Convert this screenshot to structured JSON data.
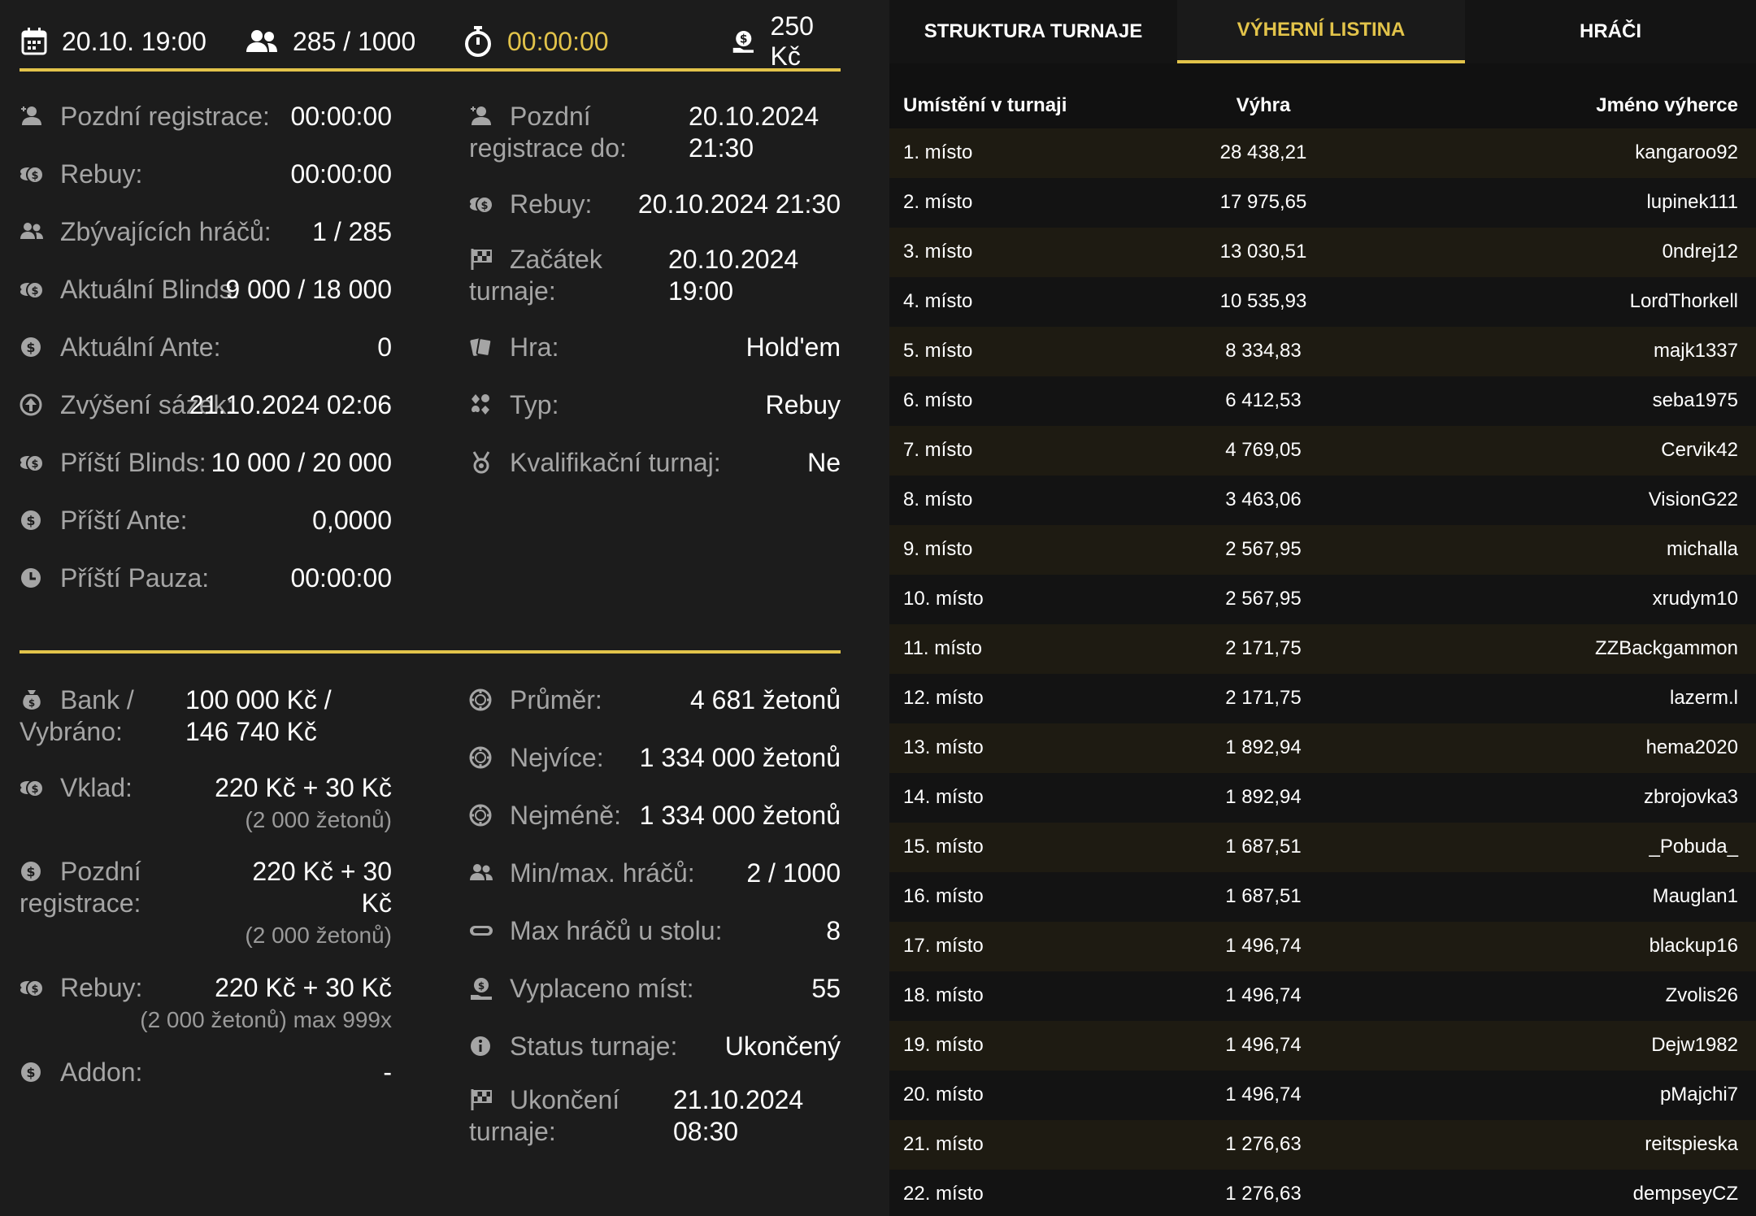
{
  "topbar": {
    "date": "20.10. 19:00",
    "players": "285 / 1000",
    "timer": "00:00:00",
    "buyin": "250 Kč"
  },
  "info_left": [
    {
      "label": "Pozdní registrace:",
      "value": "00:00:00",
      "icon": "late-registration-icon"
    },
    {
      "label": "Rebuy:",
      "value": "00:00:00",
      "icon": "coins-icon"
    },
    {
      "label": "Zbývajících hráčů:",
      "value": "1 / 285",
      "icon": "users-icon"
    },
    {
      "label": "Aktuální Blinds:",
      "value": "9 000 / 18 000",
      "icon": "coins-icon"
    },
    {
      "label": "Aktuální Ante:",
      "value": "0",
      "icon": "dollar-coin-icon"
    },
    {
      "label": "Zvýšení sázek:",
      "value": "21.10.2024 02:06",
      "icon": "arrow-up-circle-icon"
    },
    {
      "label": "Příští Blinds:",
      "value": "10 000 / 20 000",
      "icon": "coins-icon"
    },
    {
      "label": "Příští Ante:",
      "value": "0,0000",
      "icon": "dollar-coin-icon"
    },
    {
      "label": "Příští Pauza:",
      "value": "00:00:00",
      "icon": "clock-icon"
    }
  ],
  "info_right": [
    {
      "label": "Pozdní registrace do:",
      "value_line1": "20.10.2024",
      "value_line2": "21:30",
      "icon": "late-registration-icon"
    },
    {
      "label": "Rebuy:",
      "value": "20.10.2024 21:30",
      "icon": "coins-icon"
    },
    {
      "label": "Začátek turnaje:",
      "value_line1": "20.10.2024",
      "value_line2": "19:00",
      "icon": "checkered-flag-icon"
    },
    {
      "label": "Hra:",
      "value": "Hold'em",
      "icon": "cards-icon"
    },
    {
      "label": "Typ:",
      "value": "Rebuy",
      "icon": "card-suits-icon"
    },
    {
      "label": "Kvalifikační turnaj:",
      "value": "Ne",
      "icon": "medal-icon"
    }
  ],
  "money_left": {
    "bank": {
      "label": "Bank / Vybráno:",
      "value_line1": "100 000 Kč /",
      "value_line2": "146 740 Kč"
    },
    "vklad": {
      "label": "Vklad:",
      "value": "220 Kč + 30 Kč",
      "sub": "(2 000 žetonů)"
    },
    "late": {
      "label": "Pozdní registrace:",
      "value_line1": "220 Kč + 30",
      "value_line2": "Kč",
      "sub": "(2 000 žetonů)"
    },
    "rebuy": {
      "label": "Rebuy:",
      "value": "220 Kč + 30 Kč",
      "sub": "(2 000 žetonů) max 999x"
    },
    "addon": {
      "label": "Addon:",
      "value": "-"
    }
  },
  "money_right": [
    {
      "label": "Průměr:",
      "value": "4 681 žetonů",
      "icon": "chip-icon"
    },
    {
      "label": "Nejvíce:",
      "value": "1 334 000 žetonů",
      "icon": "chip-icon"
    },
    {
      "label": "Nejméně:",
      "value": "1 334 000 žetonů",
      "icon": "chip-icon"
    },
    {
      "label": "Min/max. hráčů:",
      "value": "2 / 1000",
      "icon": "users-icon"
    },
    {
      "label": "Max hráčů u stolu:",
      "value": "8",
      "icon": "table-icon"
    },
    {
      "label": "Vyplaceno míst:",
      "value": "55",
      "icon": "money-bag-icon"
    },
    {
      "label": "Status turnaje:",
      "value": "Ukončený",
      "icon": "info-icon"
    }
  ],
  "end": {
    "label": "Ukončení turnaje:",
    "value_line1": "21.10.2024",
    "value_line2": "08:30"
  },
  "tabs": [
    "STRUKTURA TURNAJE",
    "VÝHERNÍ LISTINA",
    "HRÁČI"
  ],
  "table": {
    "headers": [
      "Umístění v turnaji",
      "Výhra",
      "Jméno výherce"
    ],
    "rows": [
      [
        "1. místo",
        "28 438,21",
        "kangaroo92"
      ],
      [
        "2. místo",
        "17 975,65",
        "lupinek111"
      ],
      [
        "3. místo",
        "13 030,51",
        "0ndrej12"
      ],
      [
        "4. místo",
        "10 535,93",
        "LordThorkell"
      ],
      [
        "5. místo",
        "8 334,83",
        "majk1337"
      ],
      [
        "6. místo",
        "6 412,53",
        "seba1975"
      ],
      [
        "7. místo",
        "4 769,05",
        "Cervik42"
      ],
      [
        "8. místo",
        "3 463,06",
        "VisionG22"
      ],
      [
        "9. místo",
        "2 567,95",
        "michalla"
      ],
      [
        "10. místo",
        "2 567,95",
        "xrudym10"
      ],
      [
        "11. místo",
        "2 171,75",
        "ZZBackgammon"
      ],
      [
        "12. místo",
        "2 171,75",
        "lazerm.l"
      ],
      [
        "13. místo",
        "1 892,94",
        "hema2020"
      ],
      [
        "14. místo",
        "1 892,94",
        "zbrojovka3"
      ],
      [
        "15. místo",
        "1 687,51",
        "_Pobuda_"
      ],
      [
        "16. místo",
        "1 687,51",
        "Mauglan1"
      ],
      [
        "17. místo",
        "1 496,74",
        "blackup16"
      ],
      [
        "18. místo",
        "1 496,74",
        "Zvolis26"
      ],
      [
        "19. místo",
        "1 496,74",
        "Dejw1982"
      ],
      [
        "20. místo",
        "1 496,74",
        "pMajchi7"
      ],
      [
        "21. místo",
        "1 276,63",
        "reitspieska"
      ],
      [
        "22. místo",
        "1 276,63",
        "dempseyCZ"
      ]
    ]
  },
  "colors": {
    "accent": "#e2c34a",
    "background": "#1c1c1c",
    "table_odd": "#1e1b12"
  }
}
